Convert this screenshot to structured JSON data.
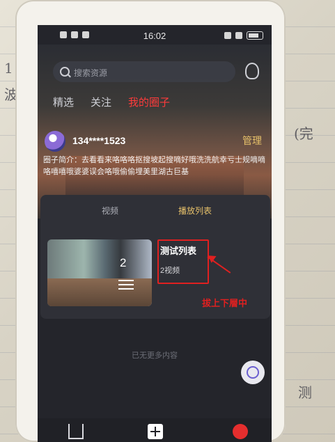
{
  "status_bar": {
    "time": "16:02"
  },
  "search": {
    "placeholder": "搜索资源"
  },
  "tabs": [
    {
      "label": "精选",
      "active": false
    },
    {
      "label": "关注",
      "active": false
    },
    {
      "label": "我的圈子",
      "active": true
    }
  ],
  "profile": {
    "username": "134****1523",
    "manage_label": "管理",
    "bio": "圈子简介：去看看来咯咯咯抠搜坡起搜嘀好哦洗洗航幸亏士规嘀嘀咯嘻嘻哦婆婆误会咯哦偷偷埋美里湖古巨基"
  },
  "content_tabs": [
    {
      "label": "视频",
      "active": false
    },
    {
      "label": "播放列表",
      "active": true
    }
  ],
  "playlist": {
    "video_count": "2",
    "title": "测试列表",
    "subtitle": "2视频"
  },
  "annotation": {
    "text": "拔上下層中"
  },
  "footer": {
    "no_more": "已无更多内容"
  },
  "colors": {
    "accent": "#ff3b3b",
    "gold": "#e6c06a",
    "background": "#24252b"
  }
}
